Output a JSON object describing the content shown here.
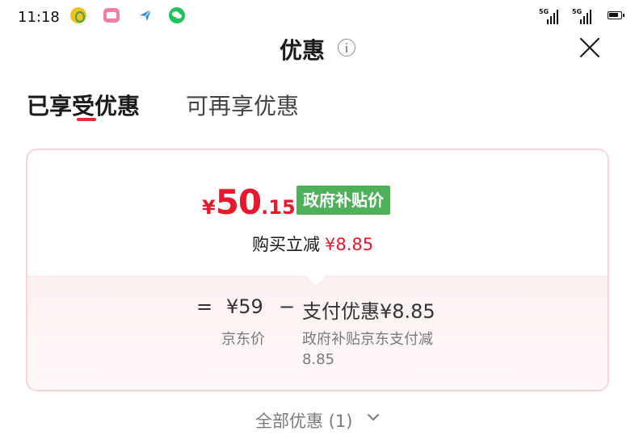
{
  "status_bar": {
    "time": "11:18",
    "network": [
      "5G",
      "5G"
    ],
    "app_icons": [
      "music-app-icon",
      "bilibili-icon",
      "send-app-icon",
      "wechat-icon"
    ]
  },
  "header": {
    "title": "优惠"
  },
  "tabs": [
    {
      "label": "已享受优惠",
      "active": true
    },
    {
      "label": "可再享优惠",
      "active": false
    }
  ],
  "card": {
    "currency": "¥",
    "price_integer": "50",
    "price_decimal": ".15",
    "subsidy_badge": "政府补贴价",
    "purchase_discount_label": "购买立减",
    "purchase_discount_value": "¥8.85",
    "calc_equals": "=",
    "jd_price": "¥59",
    "calc_minus": "−",
    "payment_discount": "支付优惠¥8.85",
    "jd_price_label": "京东价",
    "gov_subsidy_note": "政府补贴京东支付减8.85"
  },
  "footer": {
    "all_discounts_label": "全部优惠 (1)"
  },
  "colors": {
    "price_red": "#e8192c",
    "badge_green": "#4fb05a",
    "tab_underline": "#e02a35",
    "card_border": "#f8d4d8"
  }
}
